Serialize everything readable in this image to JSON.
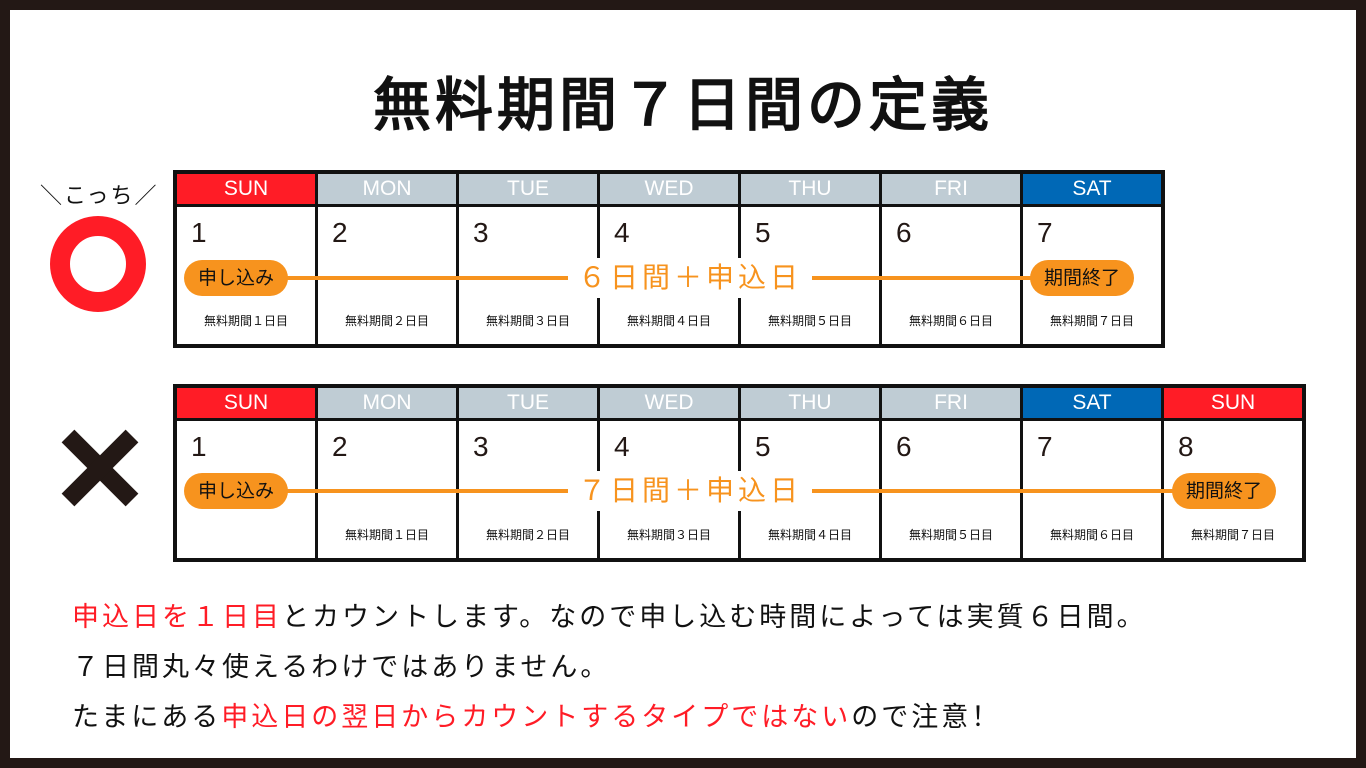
{
  "title": "無料期間７日間の定義",
  "good_label": "＼こっち／",
  "colors": {
    "sunday": "#ff1c26",
    "weekday": "#bfccd4",
    "saturday": "#0068b6",
    "accent": "#f7931e",
    "frame": "#231815"
  },
  "calendar_correct": {
    "mark": "circle-correct",
    "days": [
      {
        "dow": "SUN",
        "date": "1",
        "note": "無料期間１日目"
      },
      {
        "dow": "MON",
        "date": "2",
        "note": "無料期間２日目"
      },
      {
        "dow": "TUE",
        "date": "3",
        "note": "無料期間３日目"
      },
      {
        "dow": "WED",
        "date": "4",
        "note": "無料期間４日目"
      },
      {
        "dow": "THU",
        "date": "5",
        "note": "無料期間５日目"
      },
      {
        "dow": "FRI",
        "date": "6",
        "note": "無料期間６日目"
      },
      {
        "dow": "SAT",
        "date": "7",
        "note": "無料期間７日目"
      }
    ],
    "start_label": "申し込み",
    "span_label": "６日間＋申込日",
    "end_label": "期間終了"
  },
  "calendar_wrong": {
    "mark": "cross-wrong",
    "days": [
      {
        "dow": "SUN",
        "date": "1",
        "note": ""
      },
      {
        "dow": "MON",
        "date": "2",
        "note": "無料期間１日目"
      },
      {
        "dow": "TUE",
        "date": "3",
        "note": "無料期間２日目"
      },
      {
        "dow": "WED",
        "date": "4",
        "note": "無料期間３日目"
      },
      {
        "dow": "THU",
        "date": "5",
        "note": "無料期間４日目"
      },
      {
        "dow": "FRI",
        "date": "6",
        "note": "無料期間５日目"
      },
      {
        "dow": "SAT",
        "date": "7",
        "note": "無料期間６日目"
      },
      {
        "dow": "SUN",
        "date": "8",
        "note": "無料期間７日目"
      }
    ],
    "start_label": "申し込み",
    "span_label": "７日間＋申込日",
    "end_label": "期間終了"
  },
  "description": {
    "line1_hl": "申込日を１日目",
    "line1_rest": "とカウントします。なので申し込む時間によっては実質６日間。",
    "line2": "７日間丸々使えるわけではありません。",
    "line3_pre": "たまにある",
    "line3_hl": "申込日の翌日からカウントするタイプではない",
    "line3_post": "ので注意！"
  }
}
